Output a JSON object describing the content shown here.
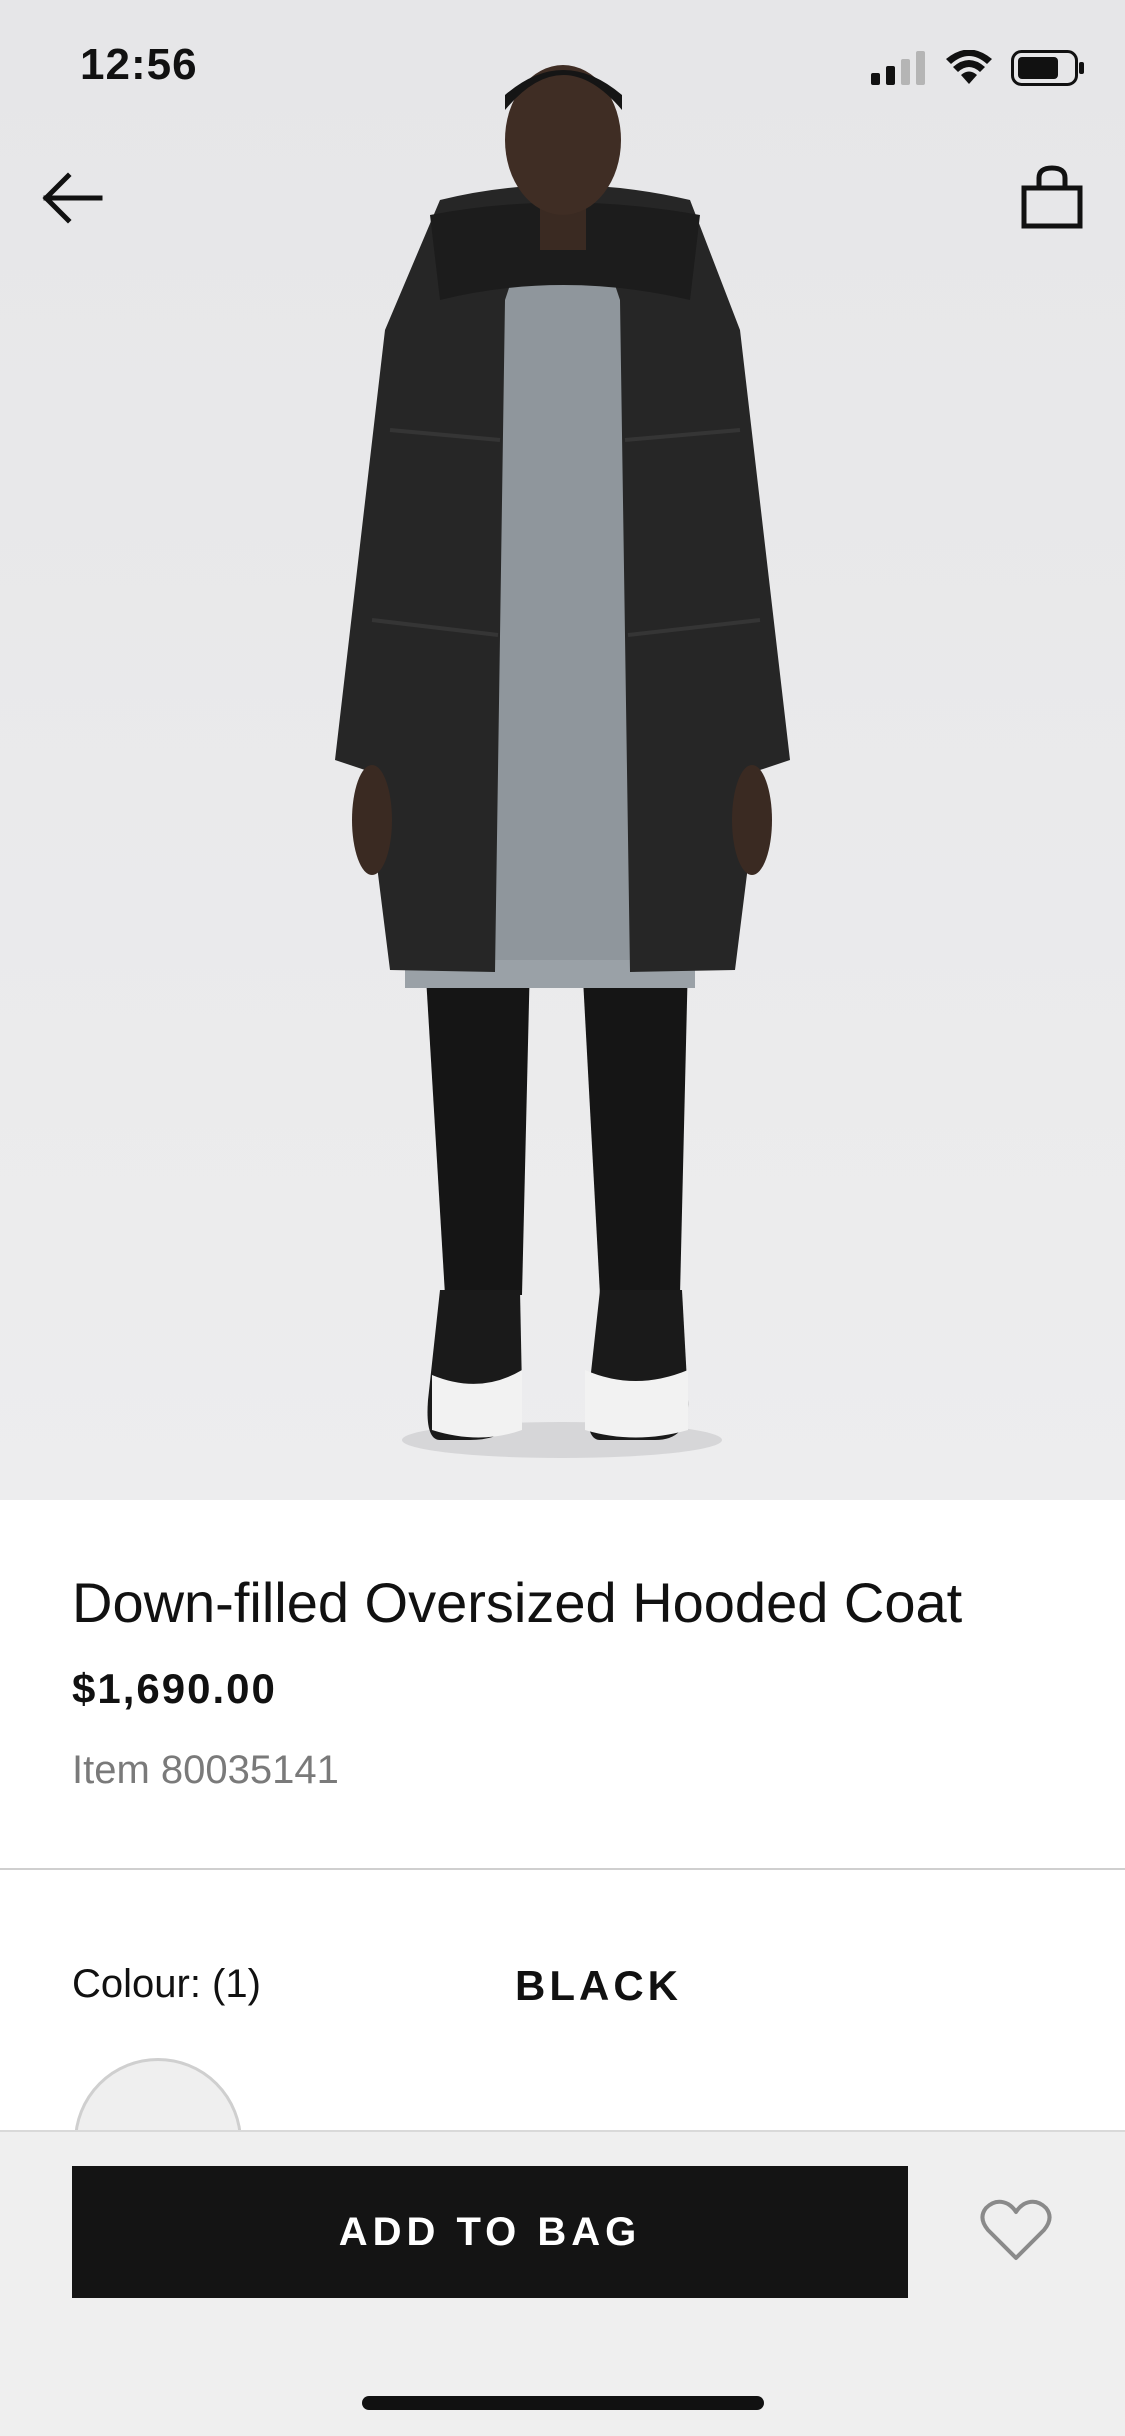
{
  "status_bar": {
    "time": "12:56"
  },
  "nav": {
    "back_icon": "arrow-left-icon",
    "bag_icon": "shopping-bag-icon"
  },
  "product": {
    "title": "Down-filled Oversized Hooded Coat",
    "price": "$1,690.00",
    "item": "Item 80035141"
  },
  "colour": {
    "label": "Colour: (1)",
    "value": "BLACK"
  },
  "actions": {
    "add_to_bag": "ADD TO BAG",
    "wishlist_icon": "heart-icon"
  },
  "colors": {
    "button_bg": "#141414",
    "hero_bg": "#e9e9eb",
    "muted_text": "#7a7a7a"
  }
}
